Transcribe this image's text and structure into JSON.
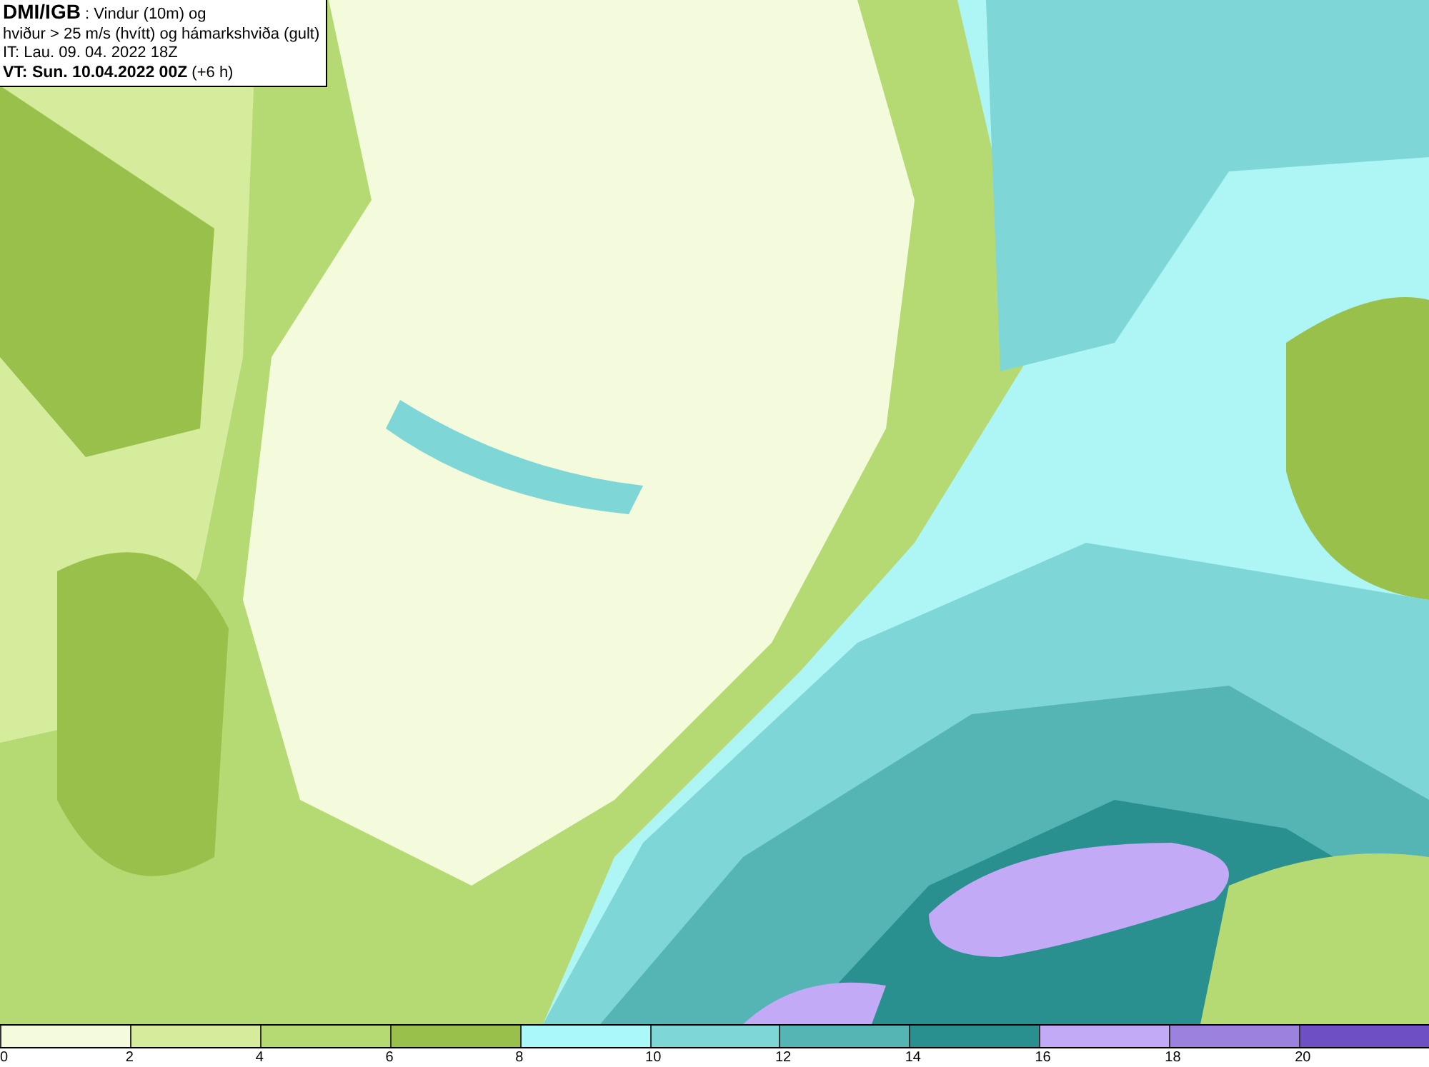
{
  "info_box": {
    "lines": [
      "**DMI/IGB** : Vindur (10m) og",
      "hviður > 25 m/s (hvítt) og hámarkshviða (gult)",
      "IT: Lau. 09. 04. 2022 18Z",
      "**VT: Sun. 10.04.2022 00Z** (+6 h)"
    ]
  },
  "legend": {
    "bins": [
      {
        "color": "#f4fbdc",
        "label": "0"
      },
      {
        "color": "#d4ec9c",
        "label": "2"
      },
      {
        "color": "#b5da74",
        "label": "4"
      },
      {
        "color": "#99c04a",
        "label": "6"
      },
      {
        "color": "#aaf8f8",
        "label": "8"
      },
      {
        "color": "#7ed6d6",
        "label": "10"
      },
      {
        "color": "#55b4b4",
        "label": "12"
      },
      {
        "color": "#2a8f8f",
        "label": "14"
      },
      {
        "color": "#c2aaf6",
        "label": "16"
      },
      {
        "color": "#9a82de",
        "label": "18"
      },
      {
        "color": "#6f4fc4",
        "label": "20"
      }
    ]
  }
}
